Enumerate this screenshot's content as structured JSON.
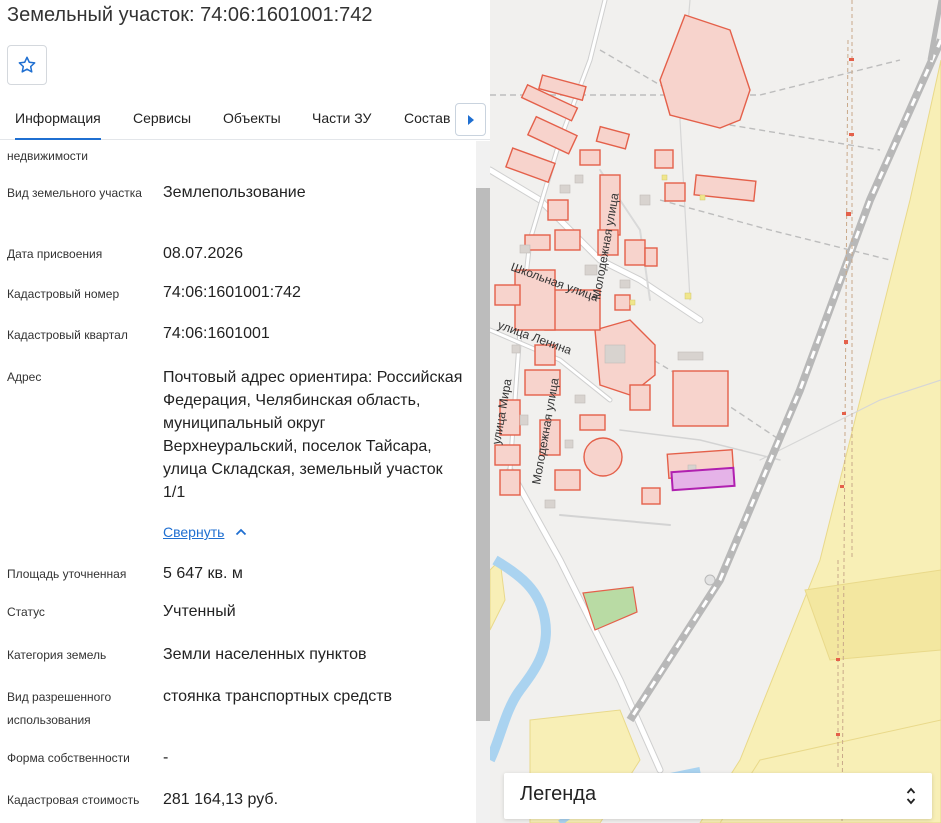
{
  "header": {
    "title": "Земельный участок: 74:06:1601001:742"
  },
  "tabs": [
    {
      "label": "Информация",
      "active": true
    },
    {
      "label": "Сервисы"
    },
    {
      "label": "Объекты"
    },
    {
      "label": "Части ЗУ"
    },
    {
      "label": "Состав"
    }
  ],
  "info": {
    "partial_top_label": "недвижимости",
    "rows": [
      {
        "label": "Вид земельного участка",
        "value": "Землепользование"
      },
      {
        "label": "Дата присвоения",
        "value": "08.07.2026"
      },
      {
        "label": "Кадастровый номер",
        "value": "74:06:1601001:742"
      },
      {
        "label": "Кадастровый квартал",
        "value": "74:06:1601001"
      },
      {
        "label": "Адрес",
        "value": "Почтовый адрес ориентира: Российская Федерация, Челябинская область, муниципальный округ Верхнеуральский, поселок Тайсара, улица Складская, земельный участок 1/1"
      },
      {
        "label": "Площадь уточненная",
        "value": "5 647 кв. м"
      },
      {
        "label": "Статус",
        "value": "Учтенный"
      },
      {
        "label": "Категория земель",
        "value": "Земли населенных пунктов"
      },
      {
        "label": "Вид разрешенного использования",
        "value": "стоянка транспортных средств"
      },
      {
        "label": "Форма собственности",
        "value": "-"
      },
      {
        "label": "Кадастровая стоимость",
        "value": "281 164,13 руб."
      }
    ],
    "collapse_link": "Свернуть"
  },
  "map": {
    "street_labels": [
      "Школьная улица",
      "Молодежная улица",
      "улица Ленина",
      "улица Мира",
      "Молодежная улица"
    ],
    "legend_label": "Легенда",
    "colors": {
      "background": "#f1f0ee",
      "parcel_fill": "#f7d3cc",
      "parcel_stroke": "#e4604a",
      "selected_parcel": "#b020b0",
      "field": "#f8efb6",
      "water": "#aad3f0",
      "railway": "#b8b8b8"
    }
  },
  "icons": {
    "favorite": "star-outline-icon",
    "tabs_next": "caret-right-icon",
    "collapse": "chevron-up-icon",
    "legend_toggle": "unfold-icon"
  }
}
